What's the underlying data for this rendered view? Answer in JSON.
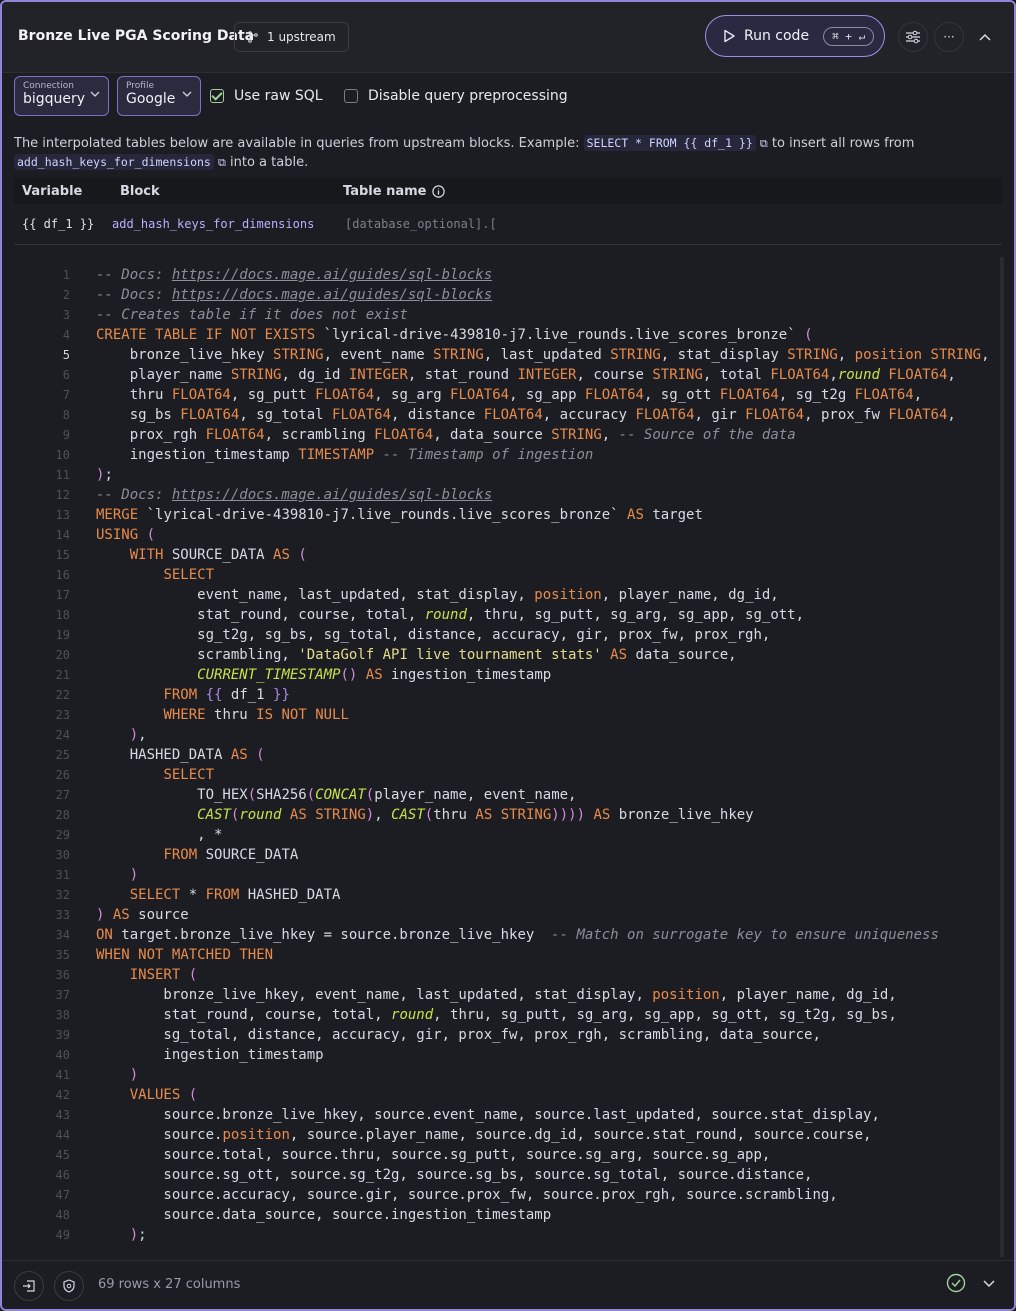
{
  "header": {
    "title": "Bronze Live PGA Scoring Data",
    "upstream_label": "1 upstream",
    "run_label": "Run code",
    "run_shortcut": "⌘ + ↵"
  },
  "toolbar": {
    "connection_label": "Connection",
    "connection_value": "bigquery",
    "profile_label": "Profile",
    "profile_value": "Google",
    "raw_sql_label": "Use raw SQL",
    "raw_sql_checked": true,
    "disable_preprocessing_label": "Disable query preprocessing",
    "disable_preprocessing_checked": false
  },
  "info": {
    "text_before": "The interpolated tables below are available in queries from upstream blocks. Example:",
    "example_code": "SELECT * FROM {{ df_1 }}",
    "text_middle": "to insert all rows from",
    "block_name": "add_hash_keys_for_dimensions",
    "text_after": "into a table."
  },
  "table": {
    "headers": [
      "Variable",
      "Block",
      "Table name"
    ],
    "rows": [
      {
        "variable": "{{ df_1 }}",
        "block": "add_hash_keys_for_dimensions",
        "table_name": "[database_optional].["
      }
    ]
  },
  "editor": {
    "active_line": 5,
    "lines": [
      "-- Docs: https://docs.mage.ai/guides/sql-blocks",
      "-- Docs: https://docs.mage.ai/guides/sql-blocks",
      "-- Creates table if it does not exist",
      "CREATE TABLE IF NOT EXISTS `lyrical-drive-439810-j7.live_rounds.live_scores_bronze` (",
      "    bronze_live_hkey STRING, event_name STRING, last_updated STRING, stat_display STRING, position STRING,",
      "    player_name STRING, dg_id INTEGER, stat_round INTEGER, course STRING, total FLOAT64,round FLOAT64,",
      "    thru FLOAT64, sg_putt FLOAT64, sg_arg FLOAT64, sg_app FLOAT64, sg_ott FLOAT64, sg_t2g FLOAT64,",
      "    sg_bs FLOAT64, sg_total FLOAT64, distance FLOAT64, accuracy FLOAT64, gir FLOAT64, prox_fw FLOAT64,",
      "    prox_rgh FLOAT64, scrambling FLOAT64, data_source STRING, -- Source of the data",
      "    ingestion_timestamp TIMESTAMP -- Timestamp of ingestion",
      ");",
      "-- Docs: https://docs.mage.ai/guides/sql-blocks",
      "MERGE `lyrical-drive-439810-j7.live_rounds.live_scores_bronze` AS target",
      "USING (",
      "    WITH SOURCE_DATA AS (",
      "        SELECT",
      "            event_name, last_updated, stat_display, position, player_name, dg_id,",
      "            stat_round, course, total, round, thru, sg_putt, sg_arg, sg_app, sg_ott,",
      "            sg_t2g, sg_bs, sg_total, distance, accuracy, gir, prox_fw, prox_rgh,",
      "            scrambling, 'DataGolf API live tournament stats' AS data_source,",
      "            CURRENT_TIMESTAMP() AS ingestion_timestamp",
      "        FROM {{ df_1 }}",
      "        WHERE thru IS NOT NULL",
      "    ),",
      "    HASHED_DATA AS (",
      "        SELECT",
      "            TO_HEX(SHA256(CONCAT(player_name, event_name,",
      "            CAST(round AS STRING), CAST(thru AS STRING)))) AS bronze_live_hkey",
      "            , *",
      "        FROM SOURCE_DATA",
      "    )",
      "    SELECT * FROM HASHED_DATA",
      ") AS source",
      "ON target.bronze_live_hkey = source.bronze_live_hkey  -- Match on surrogate key to ensure uniqueness",
      "WHEN NOT MATCHED THEN",
      "    INSERT (",
      "        bronze_live_hkey, event_name, last_updated, stat_display, position, player_name, dg_id,",
      "        stat_round, course, total, round, thru, sg_putt, sg_arg, sg_app, sg_ott, sg_t2g, sg_bs,",
      "        sg_total, distance, accuracy, gir, prox_fw, prox_rgh, scrambling, data_source,",
      "        ingestion_timestamp",
      "    )",
      "    VALUES (",
      "        source.bronze_live_hkey, source.event_name, source.last_updated, source.stat_display,",
      "        source.position, source.player_name, source.dg_id, source.stat_round, source.course,",
      "        source.total, source.thru, source.sg_putt, source.sg_arg, source.sg_app,",
      "        source.sg_ott, source.sg_t2g, source.sg_bs, source.sg_total, source.distance,",
      "        source.accuracy, source.gir, source.prox_fw, source.prox_rgh, source.scrambling,",
      "        source.data_source, source.ingestion_timestamp",
      "    );"
    ]
  },
  "footer": {
    "summary": "69 rows x 27 columns"
  },
  "icons": {
    "upstream": "branch-icon",
    "run": "play-icon",
    "settings": "sliders-icon",
    "more": "more-icon",
    "collapse": "chevron-up-icon",
    "copy": "copy-icon",
    "info": "info-icon",
    "footer_left": "exit-icon",
    "footer_second": "shield-icon",
    "status_ok": "check-circle-icon",
    "expand": "chevron-down-icon"
  },
  "colors": {
    "accent": "#8f86d8",
    "keyword": "#e98b4a",
    "function": "#c5e24a",
    "string": "#e3dc8c",
    "comment": "#8d8e99",
    "success": "#9fd19b"
  }
}
